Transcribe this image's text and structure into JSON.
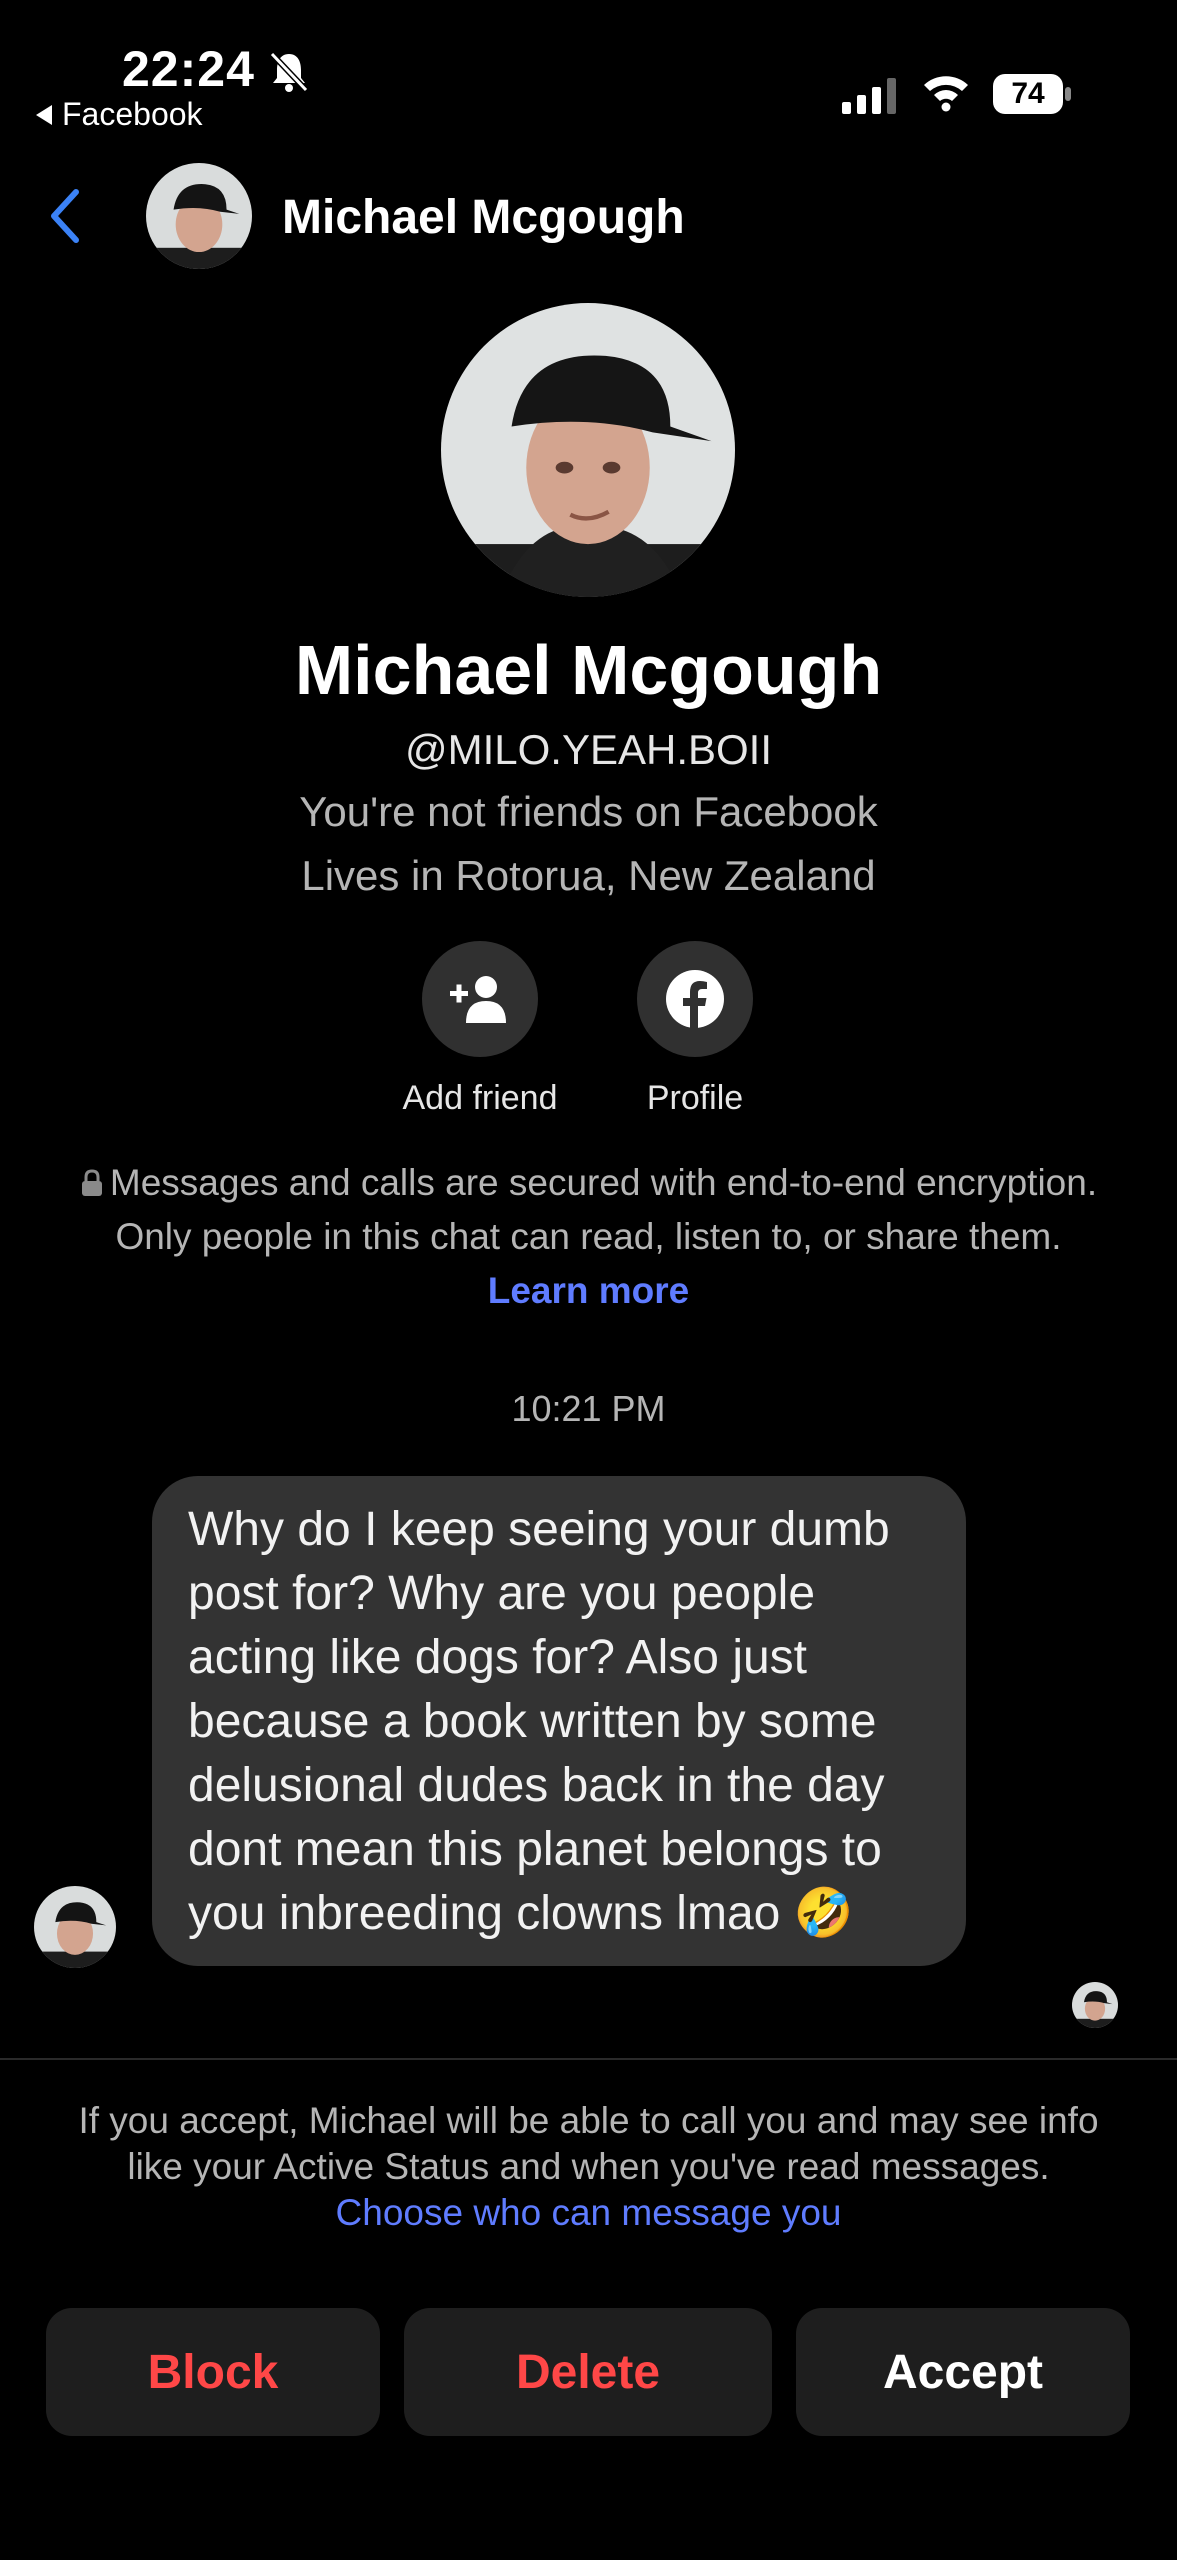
{
  "status_bar": {
    "time": "22:24",
    "back_app": "Facebook",
    "battery": "74"
  },
  "header": {
    "name": "Michael Mcgough"
  },
  "profile": {
    "name": "Michael Mcgough",
    "handle": "@MILO.YEAH.BOII",
    "friend_status": "You're not friends on Facebook",
    "location": "Lives in Rotorua, New Zealand",
    "actions": [
      {
        "label": "Add friend",
        "icon": "add-friend-icon"
      },
      {
        "label": "Profile",
        "icon": "facebook-icon"
      }
    ]
  },
  "encryption": {
    "text": "Messages and calls are secured with end-to-end encryption. Only people in this chat can read, listen to, or share them.",
    "link": "Learn more"
  },
  "conversation": {
    "timestamp": "10:21 PM",
    "message": "Why do I keep seeing your dumb post for? Why are you people acting like dogs for? Also just because a book written by some delusional dudes back in the day dont mean this planet belongs to you inbreeding clowns lmao 🤣"
  },
  "request": {
    "info": "If you accept, Michael will be able to call you and may see info like your Active Status and when you've read messages.",
    "link": "Choose who can message you",
    "buttons": {
      "block": "Block",
      "delete": "Delete",
      "accept": "Accept"
    }
  },
  "colors": {
    "accent_link": "#5f7cff",
    "destructive": "#ff4747",
    "bubble": "#333333",
    "back_chevron": "#3b82f6"
  }
}
